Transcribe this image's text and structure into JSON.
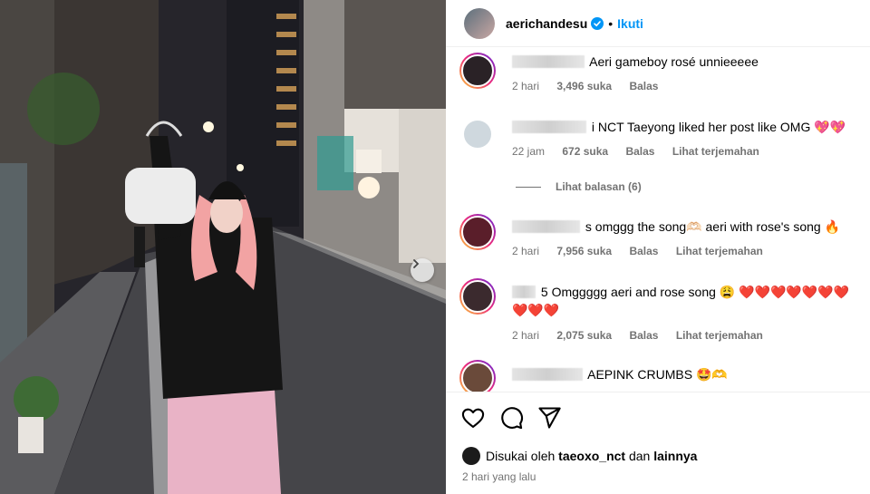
{
  "post": {
    "author": "aerichandesu",
    "follow_label": "Ikuti",
    "dot": "•",
    "next_icon": "chevron-right-icon"
  },
  "comments": [
    {
      "text": "Aeri gameboy rosé unnieeeee",
      "time": "2 hari",
      "likes": "3,496 suka",
      "reply": "Balas",
      "translate": ""
    },
    {
      "text": "i NCT Taeyong liked her post like OMG",
      "hearts": "💖💖",
      "time": "22 jam",
      "likes": "672 suka",
      "reply": "Balas",
      "translate": "Lihat terjemahan"
    },
    {
      "text": "s omggg the song🫶🏻 aeri with rose's song",
      "emoji": "🔥",
      "time": "2 hari",
      "likes": "7,956 suka",
      "reply": "Balas",
      "translate": "Lihat terjemahan"
    },
    {
      "text": "5 Omggggg aeri and rose song",
      "emoji": "😩",
      "hearts_line1": "❤️❤️❤️❤️❤️❤️❤️",
      "hearts_line2": "❤️❤️❤️",
      "time": "2 hari",
      "likes": "2,075 suka",
      "reply": "Balas",
      "translate": "Lihat terjemahan"
    },
    {
      "text": "AEPINK CRUMBS",
      "emoji": "🤩🫶"
    }
  ],
  "view_replies": "Lihat balasan (6)",
  "liked_by": {
    "prefix": "Disukai oleh",
    "user": "taeoxo_nct",
    "conj": "dan",
    "others": "lainnya"
  },
  "timestamp": "2 hari yang lalu",
  "colors": {
    "accent": "#0095f6",
    "text_muted": "#737373",
    "heart": "#e0152a"
  }
}
